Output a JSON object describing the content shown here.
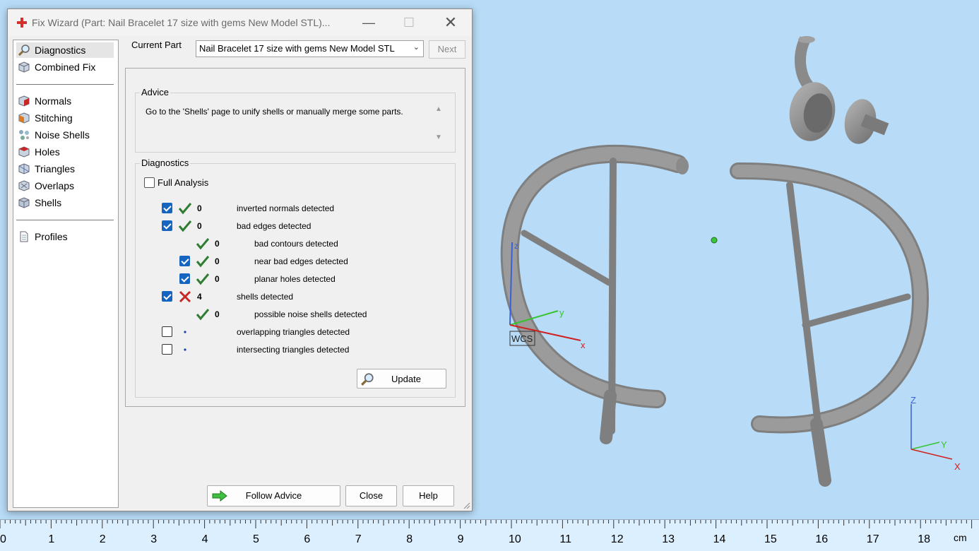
{
  "window": {
    "title": "Fix Wizard (Part: Nail Bracelet 17 size with gems New Model STL)...",
    "icon": "red-cross-icon"
  },
  "nav": {
    "items": [
      {
        "label": "Diagnostics",
        "icon": "magnifier-icon",
        "selected": true
      },
      {
        "label": "Combined Fix",
        "icon": "cube-icon"
      },
      {
        "label": "Normals",
        "icon": "cube-normals-icon"
      },
      {
        "label": "Stitching",
        "icon": "cube-stitching-icon"
      },
      {
        "label": "Noise Shells",
        "icon": "noise-shells-icon"
      },
      {
        "label": "Holes",
        "icon": "cube-holes-icon"
      },
      {
        "label": "Triangles",
        "icon": "triangles-icon"
      },
      {
        "label": "Overlaps",
        "icon": "overlaps-icon"
      },
      {
        "label": "Shells",
        "icon": "shells-icon"
      },
      {
        "label": "Profiles",
        "icon": "document-icon"
      }
    ]
  },
  "current_part": {
    "label": "Current Part",
    "value": "Nail Bracelet 17 size with gems New Model STL",
    "next_label": "Next"
  },
  "advice": {
    "title": "Advice",
    "text": "Go to the 'Shells' page to unify shells or manually merge some parts."
  },
  "diagnostics": {
    "title": "Diagnostics",
    "full_analysis_label": "Full Analysis",
    "rows": [
      {
        "checked": true,
        "status": "ok",
        "count": "0",
        "label": "inverted normals detected",
        "indent": 0
      },
      {
        "checked": true,
        "status": "ok",
        "count": "0",
        "label": "bad edges detected",
        "indent": 0
      },
      {
        "checked": null,
        "status": "ok",
        "count": "0",
        "label": "bad contours detected",
        "indent": 1
      },
      {
        "checked": true,
        "status": "ok",
        "count": "0",
        "label": "near bad edges detected",
        "indent": 1
      },
      {
        "checked": true,
        "status": "ok",
        "count": "0",
        "label": "planar holes detected",
        "indent": 1
      },
      {
        "checked": true,
        "status": "error",
        "count": "4",
        "label": "shells detected",
        "indent": 0
      },
      {
        "checked": null,
        "status": "ok",
        "count": "0",
        "label": "possible noise shells detected",
        "indent": 1
      },
      {
        "checked": false,
        "status": "dot",
        "count": "",
        "label": "overlapping triangles detected",
        "indent": 0
      },
      {
        "checked": false,
        "status": "dot",
        "count": "",
        "label": "intersecting triangles detected",
        "indent": 0
      }
    ],
    "update_label": "Update"
  },
  "buttons": {
    "follow_advice": "Follow Advice",
    "close": "Close",
    "help": "Help"
  },
  "viewport": {
    "wcs_label": "WCS",
    "axis_x": "x",
    "axis_y": "y",
    "axis_z": "z",
    "mini_x": "X",
    "mini_y": "Y",
    "mini_z": "Z"
  },
  "ruler": {
    "labels": [
      "0",
      "1",
      "2",
      "3",
      "4",
      "5",
      "6",
      "7",
      "8",
      "9",
      "10",
      "11",
      "12",
      "13",
      "14",
      "15",
      "16",
      "17",
      "18"
    ],
    "unit": "cm"
  },
  "colors": {
    "viewport_bg": "#b8dcf7",
    "model_gray": "#8f8f8f",
    "check_blue": "#1565c0",
    "ok_green": "#2e7d32",
    "error_red": "#c62828"
  }
}
